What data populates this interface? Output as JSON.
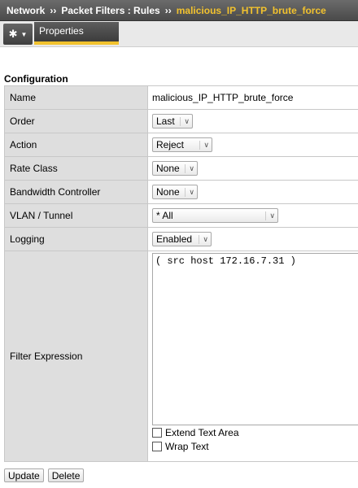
{
  "breadcrumb": {
    "items": [
      "Network",
      "Packet Filters : Rules"
    ],
    "separator": "››",
    "current": "malicious_IP_HTTP_brute_force"
  },
  "tabs": {
    "gear_icon": "✱",
    "properties_label": "Properties"
  },
  "section": {
    "title": "Configuration"
  },
  "form": {
    "name_label": "Name",
    "name_value": "malicious_IP_HTTP_brute_force",
    "order_label": "Order",
    "order_value": "Last",
    "action_label": "Action",
    "action_value": "Reject",
    "rate_class_label": "Rate Class",
    "rate_class_value": "None",
    "bandwidth_label": "Bandwidth Controller",
    "bandwidth_value": "None",
    "vlan_label": "VLAN / Tunnel",
    "vlan_value": "* All",
    "logging_label": "Logging",
    "logging_value": "Enabled",
    "filter_label": "Filter Expression",
    "filter_value": "( src host 172.16.7.31 )",
    "extend_label": "Extend Text Area",
    "wrap_label": "Wrap Text"
  },
  "buttons": {
    "update": "Update",
    "delete": "Delete"
  },
  "colors": {
    "accent": "#f2c22e",
    "header_bg": "#4a4a4a",
    "label_bg": "#dedede"
  }
}
